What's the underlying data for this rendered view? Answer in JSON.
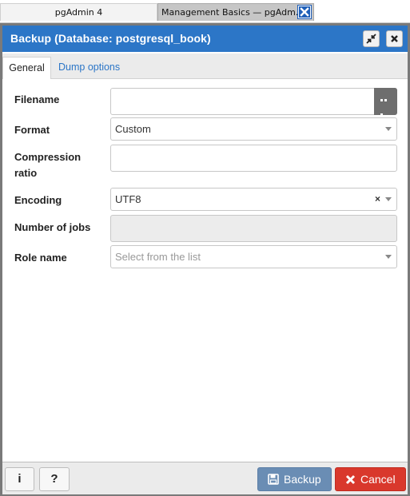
{
  "browser": {
    "tabs": [
      {
        "label": "pgAdmin 4"
      },
      {
        "label": "Management Basics — pgAdm..."
      }
    ]
  },
  "dialog": {
    "title": "Backup (Database: postgresql_book)",
    "tabs": [
      {
        "label": "General",
        "active": true
      },
      {
        "label": "Dump options",
        "active": false
      }
    ],
    "form": {
      "filename": {
        "label": "Filename",
        "value": ""
      },
      "format": {
        "label": "Format",
        "value": "Custom"
      },
      "compression": {
        "label_line1": "Compression",
        "label_line2": "ratio",
        "value": ""
      },
      "encoding": {
        "label": "Encoding",
        "value": "UTF8"
      },
      "jobs": {
        "label": "Number of jobs",
        "value": ""
      },
      "role": {
        "label": "Role name",
        "placeholder": "Select from the list"
      }
    },
    "footer": {
      "info_icon": "info-icon",
      "help_icon": "question-icon",
      "backup_label": "Backup",
      "cancel_label": "Cancel"
    }
  },
  "colors": {
    "titlebar": "#2c76c7",
    "backup_button": "#6a8db4",
    "cancel_button": "#d9382c",
    "link_tab": "#2c76c7"
  }
}
